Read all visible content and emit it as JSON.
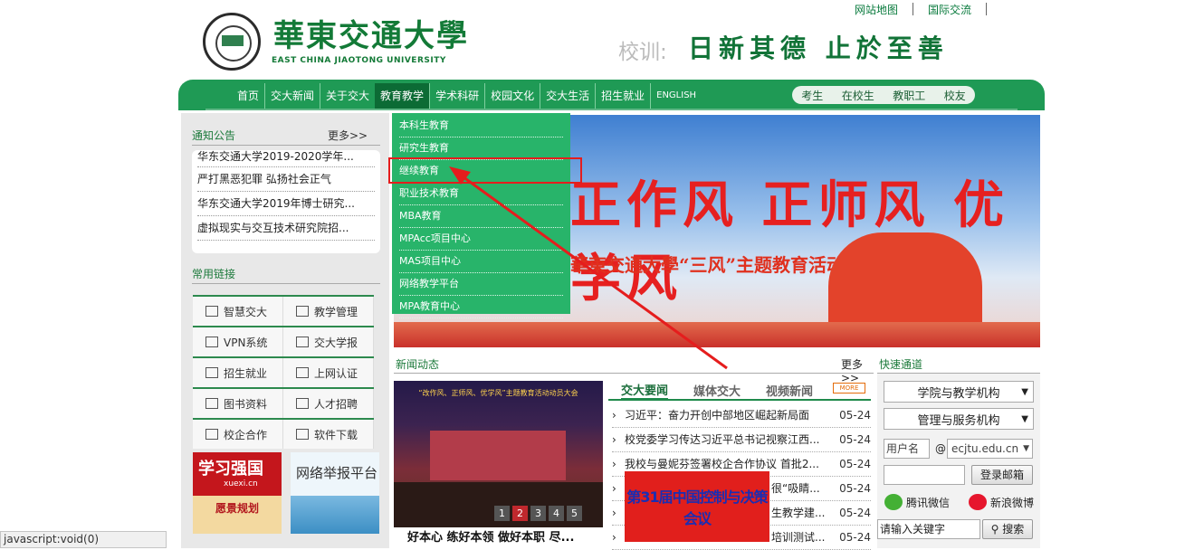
{
  "header": {
    "links": [
      "网站地图",
      "国际交流"
    ],
    "logo_cn": "華東交通大學",
    "logo_en": "EAST CHINA JIAOTONG UNIVERSITY",
    "motto_label": "校训:",
    "motto": "日新其德 止於至善"
  },
  "nav": {
    "items": [
      "首页",
      "交大新闻",
      "关于交大",
      "教育教学",
      "学术科研",
      "校园文化",
      "交大生活",
      "招生就业",
      "ENGLISH"
    ],
    "active": "教育教学",
    "right": [
      "考生",
      "在校生",
      "教职工",
      "校友"
    ]
  },
  "dropdown": {
    "items": [
      "本科生教育",
      "研究生教育",
      "继续教育",
      "职业技术教育",
      "MBA教育",
      "MPAcc项目中心",
      "MAS项目中心",
      "网络教学平台",
      "MPA教育中心"
    ],
    "highlighted": "继续教育"
  },
  "notice": {
    "title": "通知公告",
    "more": "更多>>",
    "items": [
      "华东交通大学2019-2020学年...",
      "严打黑恶犯罪 弘扬社会正气",
      "华东交通大学2019年博士研究...",
      "虚拟现实与交互技术研究院招..."
    ]
  },
  "links": {
    "title": "常用链接",
    "items": [
      {
        "label": "智慧交大",
        "icon": "mail-icon"
      },
      {
        "label": "教学管理",
        "icon": "grid-icon"
      },
      {
        "label": "VPN系统",
        "icon": "vpn-icon"
      },
      {
        "label": "交大学报",
        "icon": "journal-icon"
      },
      {
        "label": "招生就业",
        "icon": "calendar-icon"
      },
      {
        "label": "上网认证",
        "icon": "phone-icon"
      },
      {
        "label": "图书资料",
        "icon": "book-icon"
      },
      {
        "label": "人才招聘",
        "icon": "recruit-icon"
      },
      {
        "label": "校企合作",
        "icon": "chat-icon"
      },
      {
        "label": "软件下载",
        "icon": "download-icon"
      }
    ],
    "banner_left": {
      "title": "学习强国",
      "site": "xuexi.cn",
      "sub": "愿景规划"
    },
    "banner_right": {
      "title": "网络举报平台"
    }
  },
  "banner": {
    "title": "正作风 正师风 优学风",
    "subtitle": "華東交通大學“三风”主题教育活动"
  },
  "news": {
    "title": "新闻动态",
    "more": "更多>>",
    "image_caption": "好本心 练好本领 做好本职 尽...",
    "image_banner": "“改作风、正师风、优学风”主题教育活动动员大会",
    "pages": [
      "1",
      "2",
      "3",
      "4",
      "5"
    ],
    "active_page": "2",
    "tabs": [
      "交大要闻",
      "媒体交大",
      "视频新闻"
    ],
    "more_badge": "MORE",
    "items": [
      {
        "title": "习近平：奋力开创中部地区崛起新局面",
        "date": "05-24"
      },
      {
        "title": "校党委学习传达习近平总书记视察江西...",
        "date": "05-24"
      },
      {
        "title": "我校与曼妮芬签署校企合作协议 首批2...",
        "date": "05-24"
      },
      {
        "title": "很“吸睛...",
        "date": "05-24"
      },
      {
        "title": "生教学建...",
        "date": "05-24"
      },
      {
        "title": "培训测试...",
        "date": "05-24"
      }
    ],
    "popup_text": "第31届中国控制与决策会议"
  },
  "quick": {
    "title": "快速通道",
    "select1": "学院与教学机构",
    "select2": "管理与服务机构",
    "username_placeholder": "用户名",
    "at": "@",
    "domain": "ecjtu.edu.cn",
    "login_button": "登录邮箱",
    "wechat": "腾讯微信",
    "weibo": "新浪微博",
    "search_placeholder": "请输入关键字",
    "search_button": "搜索"
  },
  "statusbar": "javascript:void(0)",
  "colors": {
    "brand_green": "#1f9a55",
    "dropdown": "#28b46a",
    "highlight_red": "#e51d1d"
  }
}
